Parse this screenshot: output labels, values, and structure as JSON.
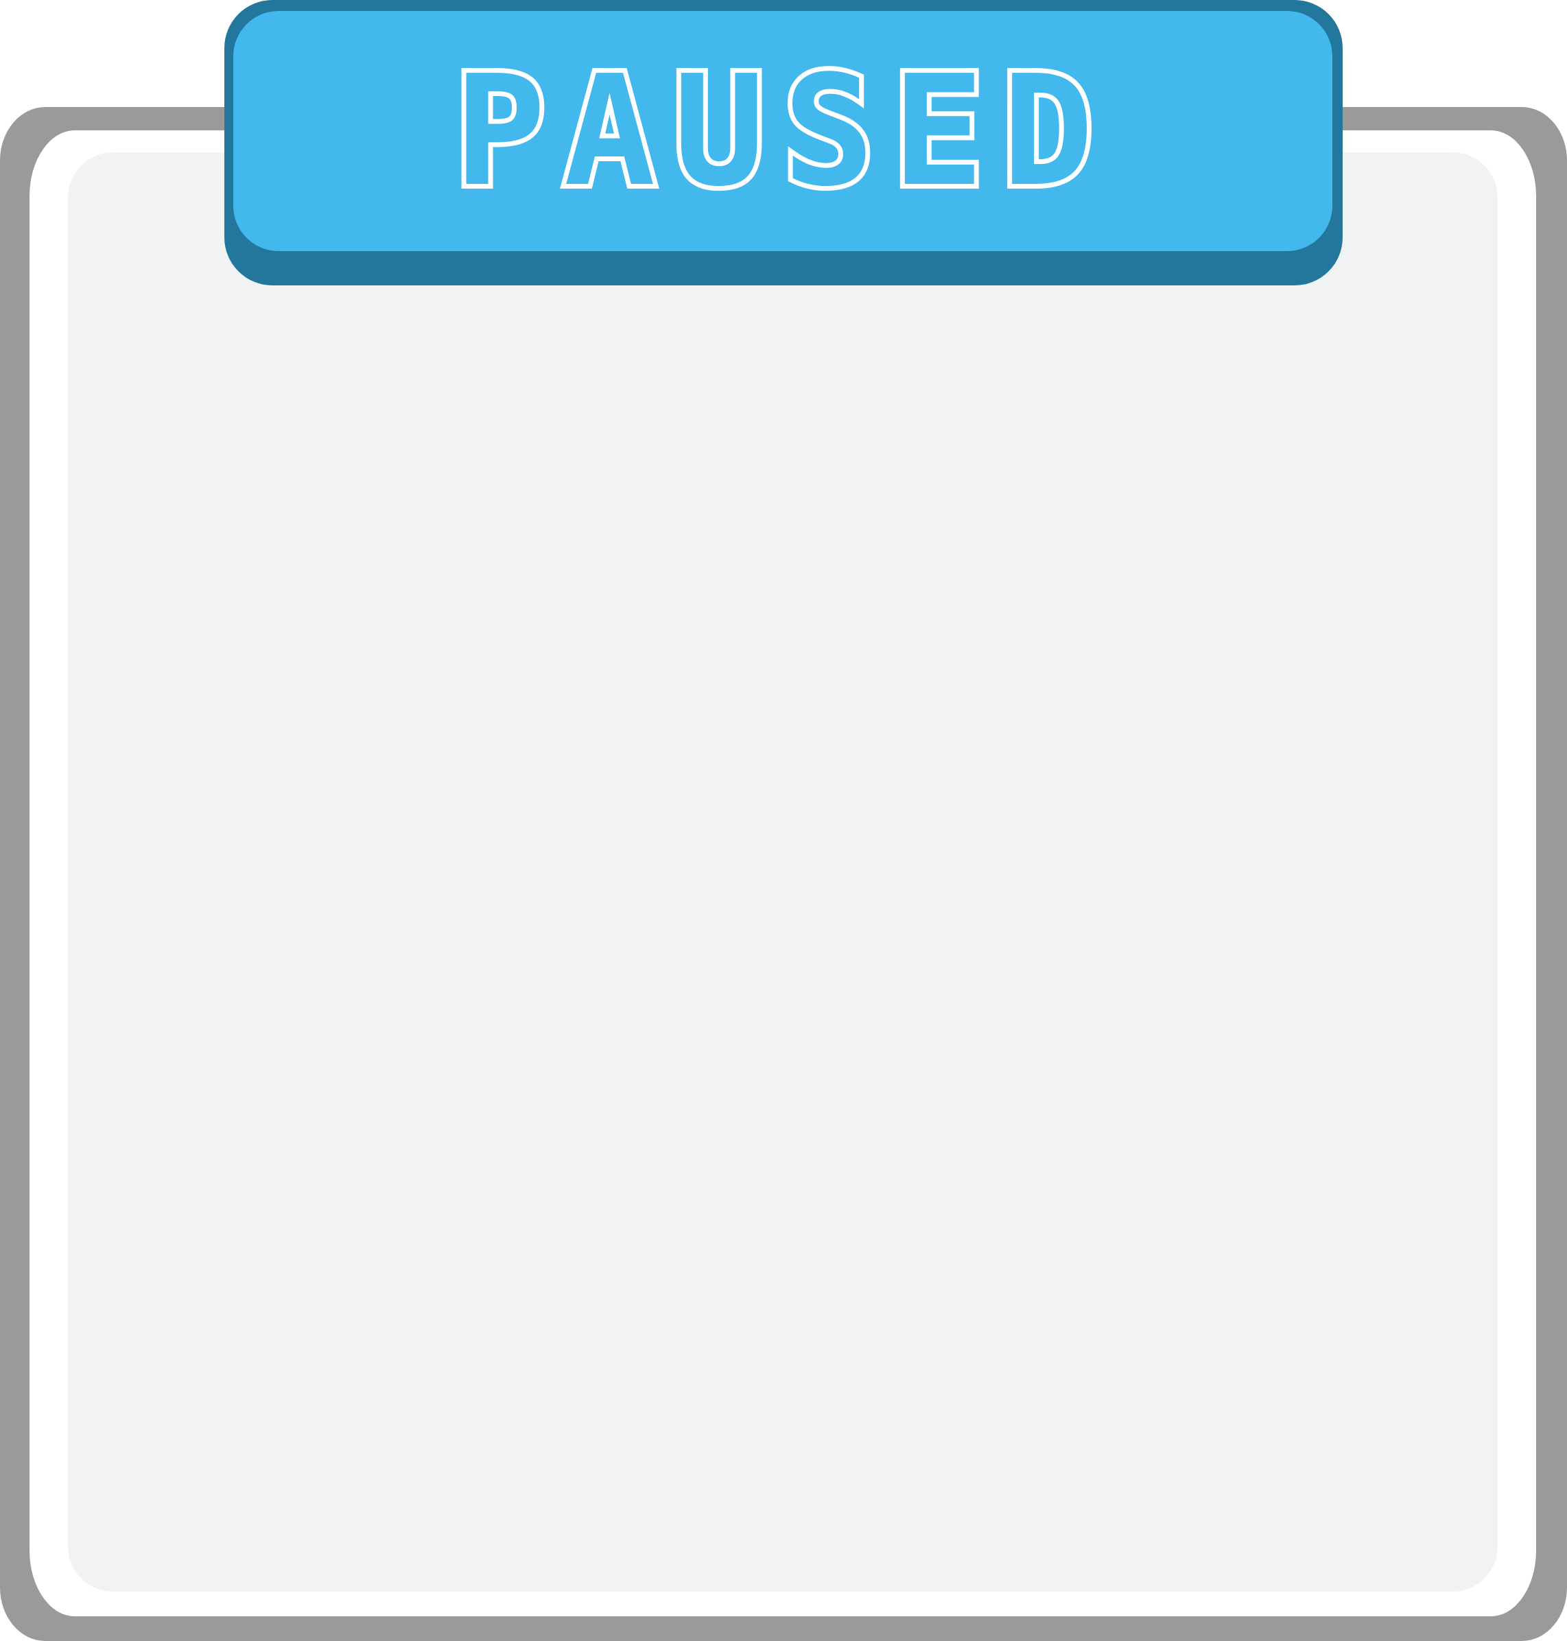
{
  "pause_dialog": {
    "title": "PAUSED",
    "colors": {
      "banner_face": "#43b8ec",
      "banner_shadow": "#23769c",
      "panel_border": "#9a9a9a",
      "panel_rim": "#ffffff",
      "panel_body": "#f1f2f4",
      "title_text": "#ffffff"
    }
  }
}
